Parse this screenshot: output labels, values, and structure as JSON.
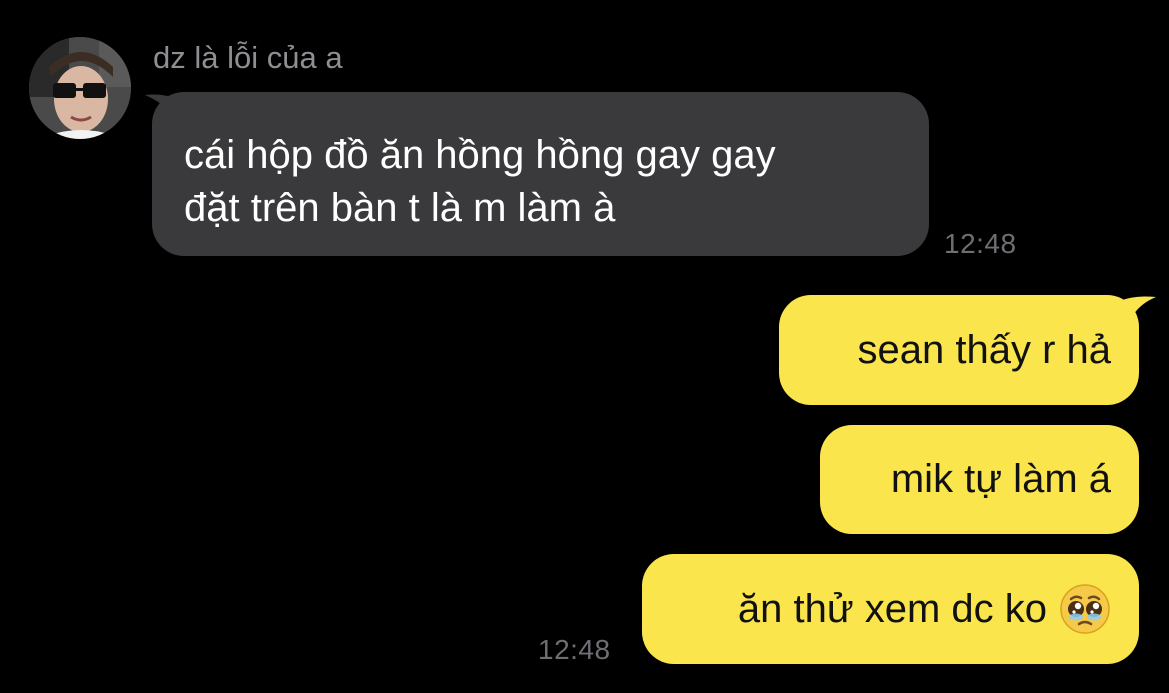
{
  "conversation": {
    "sender_name": "dz là lỗi của a",
    "incoming": {
      "lines": [
        "cái hộp đồ ăn hồng hồng gay gay",
        "đặt trên bàn t là m làm à"
      ],
      "time": "12:48"
    },
    "outgoing": [
      {
        "text": "sean thấy r hả"
      },
      {
        "text": "mik tự làm á"
      },
      {
        "text": "ăn thử xem dc ko",
        "emoji": "pleading-face-icon"
      }
    ],
    "outgoing_time": "12:48"
  },
  "colors": {
    "background": "#000000",
    "incoming_bubble": "#3a3a3c",
    "outgoing_bubble": "#fbe54d",
    "timestamp": "#6e6e73",
    "sender_name": "#8e8e93"
  }
}
